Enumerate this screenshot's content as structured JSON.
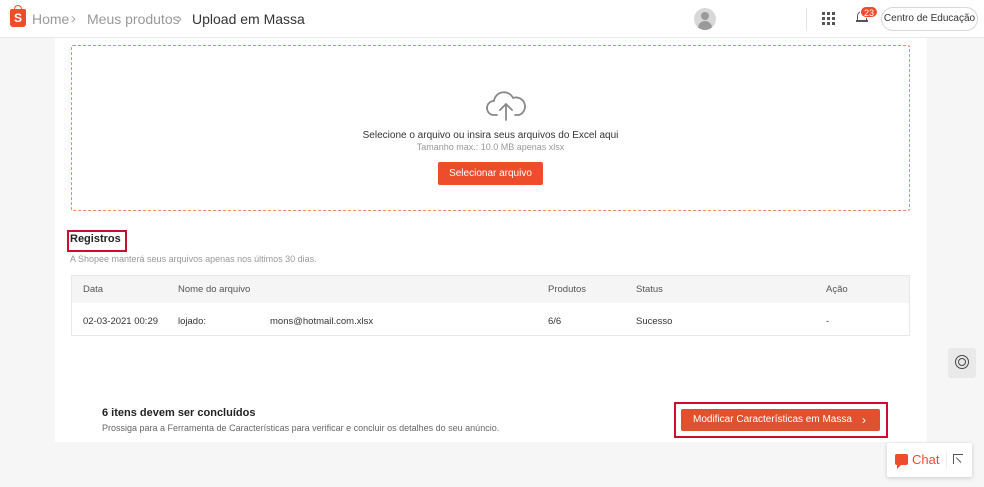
{
  "header": {
    "logo_letter": "S",
    "breadcrumb": [
      "Home",
      "Meus produtos",
      "Upload em Massa"
    ],
    "notifications_count": "23",
    "education_label": "Centro de Educação"
  },
  "upload": {
    "title": "Selecione o arquivo ou insira seus arquivos do Excel aqui",
    "subtitle": "Tamanho max.: 10.0 MB apenas xlsx",
    "button_label": "Selecionar arquivo"
  },
  "records": {
    "title": "Registros",
    "note": "A Shopee manterá seus arquivos apenas nos últimos 30 dias.",
    "columns": [
      "Data",
      "Nome do arquivo",
      "Produtos",
      "Status",
      "Ação"
    ],
    "rows": [
      {
        "date": "02-03-2021 00:29",
        "file_prefix": "lojado:",
        "file_suffix": "mons@hotmail.com.xlsx",
        "products": "6/6",
        "status": "Sucesso",
        "action": "-"
      }
    ]
  },
  "todo": {
    "title": "6 itens devem ser concluídos",
    "subtitle": "Prossiga para a Ferramenta de Características para verificar e concluir os detalhes do seu anúncio.",
    "button_label": "Modificar Características em Massa"
  },
  "chat": {
    "label": "Chat"
  },
  "icons": [
    "shopee-logo-icon",
    "avatar-icon",
    "apps-grid-icon",
    "bell-icon",
    "cloud-upload-icon",
    "chevron-right-icon",
    "headset-icon",
    "chat-icon",
    "expand-icon"
  ],
  "colors": {
    "accent": "#ee4d2d",
    "highlight": "#c8102e"
  }
}
